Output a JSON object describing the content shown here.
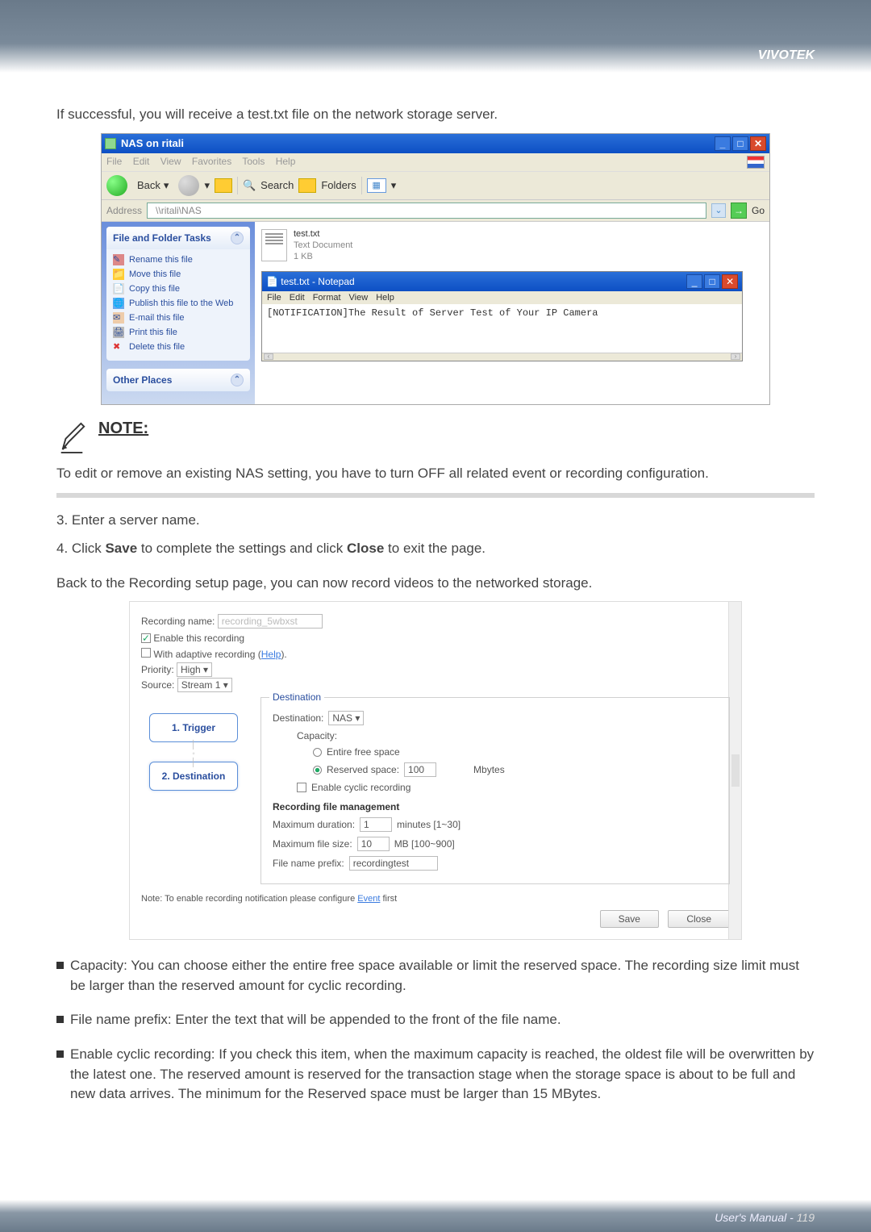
{
  "brand": "VIVOTEK",
  "intro": "If successful, you will receive a test.txt file on the network storage server.",
  "explorer": {
    "title": "NAS on ritali",
    "menus": [
      "File",
      "Edit",
      "View",
      "Favorites",
      "Tools",
      "Help"
    ],
    "back": "Back",
    "search": "Search",
    "folders": "Folders",
    "address_label": "Address",
    "address": "\\\\ritali\\NAS",
    "go": "Go",
    "side_heads": {
      "tasks": "File and Folder Tasks",
      "other": "Other Places"
    },
    "tasks": [
      "Rename this file",
      "Move this file",
      "Copy this file",
      "Publish this file to the Web",
      "E-mail this file",
      "Print this file",
      "Delete this file"
    ],
    "file": {
      "name": "test.txt",
      "type": "Text Document",
      "size": "1 KB"
    },
    "notepad": {
      "title": "test.txt - Notepad",
      "menus": [
        "File",
        "Edit",
        "Format",
        "View",
        "Help"
      ],
      "body": "[NOTIFICATION]The Result of Server Test of Your IP Camera"
    }
  },
  "note": {
    "label": "NOTE:",
    "text": "To edit or remove an existing NAS setting, you have to turn OFF all related event or recording configuration."
  },
  "step3": "3. Enter a server name.",
  "step4a": "4. Click ",
  "step4b": "Save",
  "step4c": " to complete the settings and click ",
  "step4d": "Close",
  "step4e": " to exit the page.",
  "back_text": "Back to the Recording setup page, you can now record videos to the networked storage.",
  "rec": {
    "name_label": "Recording name:",
    "name_ph": "recording_5wbxst",
    "enable": "Enable this recording",
    "adaptive": "With adaptive recording (",
    "help": "Help",
    "priority_label": "Priority:",
    "priority": "High",
    "source_label": "Source:",
    "source": "Stream 1",
    "tabs": {
      "trigger": "1. Trigger",
      "dest": "2. Destination"
    },
    "legend": "Destination",
    "dest_label": "Destination:",
    "dest_val": "NAS",
    "capacity": "Capacity:",
    "entire": "Entire free space",
    "reserved": "Reserved space:",
    "reserved_val": "100",
    "mbytes": "Mbytes",
    "cyclic": "Enable cyclic recording",
    "mgmt": "Recording file management",
    "maxdur": "Maximum duration:",
    "maxdur_val": "1",
    "maxdur_unit": "minutes [1~30]",
    "maxfile": "Maximum file size:",
    "maxfile_val": "10",
    "maxfile_unit": "MB [100~900]",
    "prefix": "File name prefix:",
    "prefix_val": "recordingtest",
    "note_line": "Note: To enable recording notification please configure ",
    "event": "Event",
    "first": " first",
    "save": "Save",
    "close": "Close"
  },
  "bullets": {
    "cap": "Capacity: You can choose either the entire free space available or limit the reserved space. The recording size limit must be larger than the reserved amount for cyclic recording.",
    "prefix": "File name prefix: Enter the text that will be appended to the front of the file name.",
    "cyclic": "Enable cyclic recording: If you check this item, when the maximum capacity is reached, the oldest file will be overwritten by the latest one. The reserved amount is reserved for the transaction stage when the storage space is about to be full and new data arrives. The minimum for the Reserved space must be larger than 15 MBytes."
  },
  "footer": {
    "label": "User's Manual - ",
    "page": "119"
  }
}
